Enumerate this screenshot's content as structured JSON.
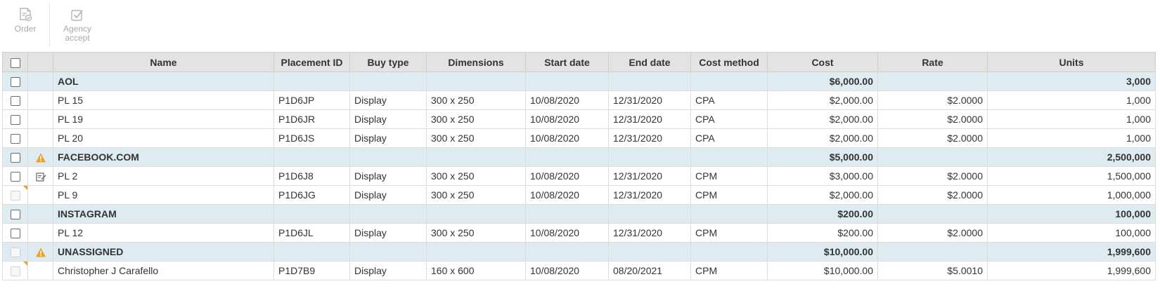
{
  "toolbar": {
    "order_label": "Order",
    "agency_accept_label": "Agency\naccept"
  },
  "grid": {
    "columns": {
      "name": "Name",
      "placement_id": "Placement ID",
      "buy_type": "Buy type",
      "dimensions": "Dimensions",
      "start_date": "Start date",
      "end_date": "End date",
      "cost_method": "Cost method",
      "cost": "Cost",
      "rate": "Rate",
      "units": "Units"
    },
    "groups": [
      {
        "name": "AOL",
        "cost": "$6,000.00",
        "units": "3,000",
        "warning": false,
        "checkbox_disabled": false,
        "rows": [
          {
            "name": "PL 15",
            "placement_id": "P1D6JP",
            "buy_type": "Display",
            "dimensions": "300 x 250",
            "start_date": "10/08/2020",
            "end_date": "12/31/2020",
            "cost_method": "CPA",
            "cost": "$2,000.00",
            "rate": "$2.0000",
            "units": "1,000",
            "icon": "",
            "checkbox_disabled": false
          },
          {
            "name": "PL 19",
            "placement_id": "P1D6JR",
            "buy_type": "Display",
            "dimensions": "300 x 250",
            "start_date": "10/08/2020",
            "end_date": "12/31/2020",
            "cost_method": "CPA",
            "cost": "$2,000.00",
            "rate": "$2.0000",
            "units": "1,000",
            "icon": "",
            "checkbox_disabled": false
          },
          {
            "name": "PL 20",
            "placement_id": "P1D6JS",
            "buy_type": "Display",
            "dimensions": "300 x 250",
            "start_date": "10/08/2020",
            "end_date": "12/31/2020",
            "cost_method": "CPA",
            "cost": "$2,000.00",
            "rate": "$2.0000",
            "units": "1,000",
            "icon": "",
            "checkbox_disabled": false
          }
        ]
      },
      {
        "name": "FACEBOOK.COM",
        "cost": "$5,000.00",
        "units": "2,500,000",
        "warning": true,
        "checkbox_disabled": false,
        "rows": [
          {
            "name": "PL 2",
            "placement_id": "P1D6J8",
            "buy_type": "Display",
            "dimensions": "300 x 250",
            "start_date": "10/08/2020",
            "end_date": "12/31/2020",
            "cost_method": "CPM",
            "cost": "$3,000.00",
            "rate": "$2.0000",
            "units": "1,500,000",
            "icon": "edit-icon",
            "checkbox_disabled": false
          },
          {
            "name": "PL 9",
            "placement_id": "P1D6JG",
            "buy_type": "Display",
            "dimensions": "300 x 250",
            "start_date": "10/08/2020",
            "end_date": "12/31/2020",
            "cost_method": "CPM",
            "cost": "$2,000.00",
            "rate": "$2.0000",
            "units": "1,000,000",
            "icon": "",
            "checkbox_disabled": true,
            "flag": true
          }
        ]
      },
      {
        "name": "INSTAGRAM",
        "cost": "$200.00",
        "units": "100,000",
        "warning": false,
        "checkbox_disabled": false,
        "rows": [
          {
            "name": "PL 12",
            "placement_id": "P1D6JL",
            "buy_type": "Display",
            "dimensions": "300 x 250",
            "start_date": "10/08/2020",
            "end_date": "12/31/2020",
            "cost_method": "CPM",
            "cost": "$200.00",
            "rate": "$2.0000",
            "units": "100,000",
            "icon": "",
            "checkbox_disabled": false
          }
        ]
      },
      {
        "name": "UNASSIGNED",
        "cost": "$10,000.00",
        "units": "1,999,600",
        "warning": true,
        "checkbox_disabled": true,
        "rows": [
          {
            "name": "Christopher J Carafello",
            "placement_id": "P1D7B9",
            "buy_type": "Display",
            "dimensions": "160 x 600",
            "start_date": "10/08/2020",
            "end_date": "08/20/2021",
            "cost_method": "CPM",
            "cost": "$10,000.00",
            "rate": "$5.0010",
            "units": "1,999,600",
            "icon": "",
            "checkbox_disabled": true,
            "flag": true
          }
        ]
      }
    ]
  },
  "colors": {
    "header_bg": "#e3e3e3",
    "group_bg": "#deebf0",
    "warning": "#f0a020",
    "toolbar_disabled": "#a8a8a8"
  }
}
